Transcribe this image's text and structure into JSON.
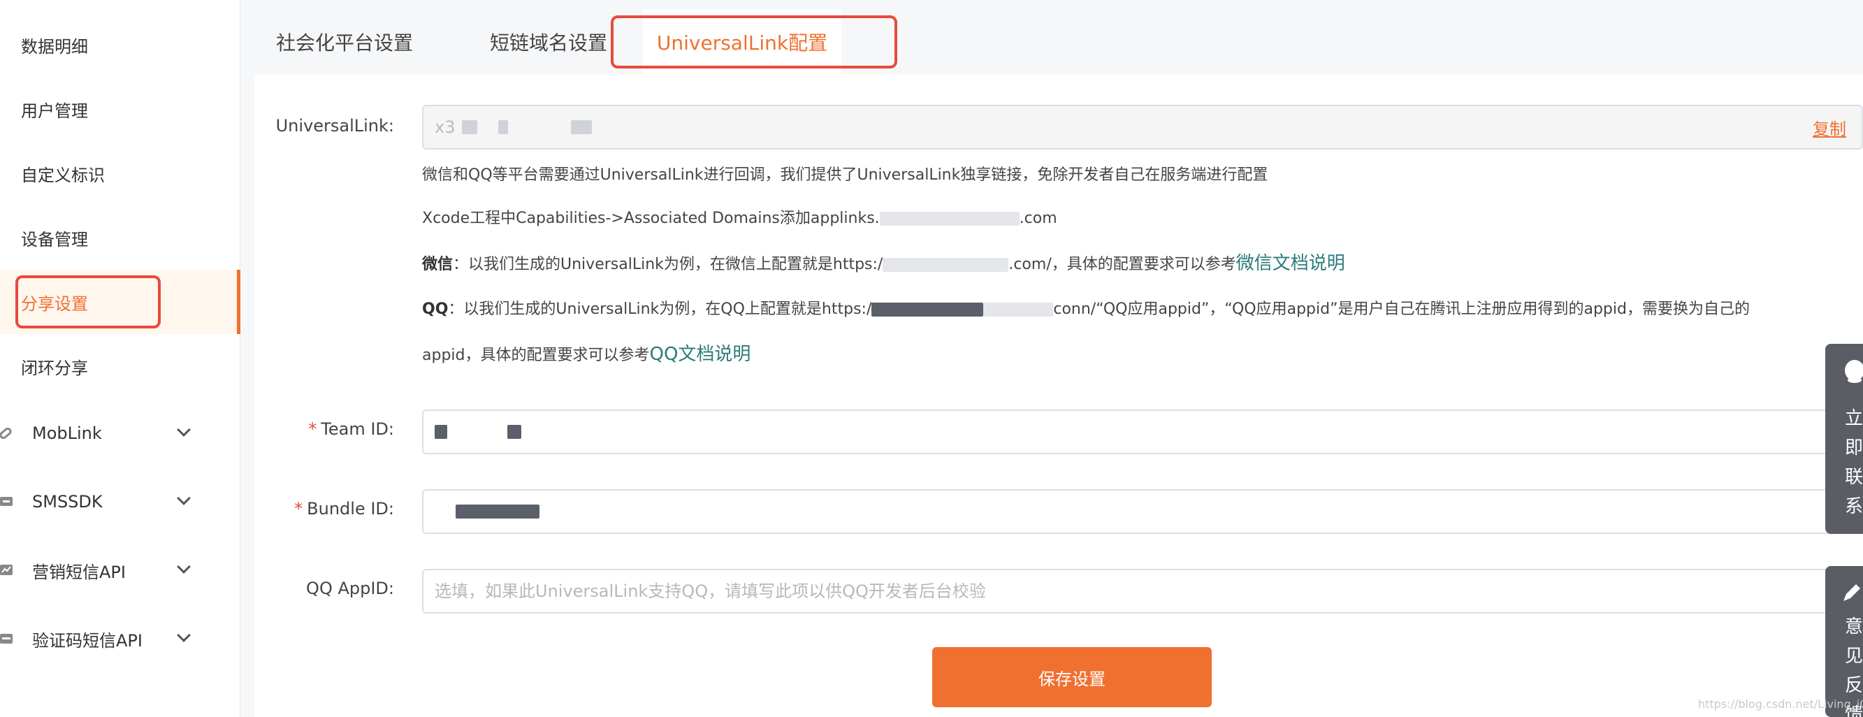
{
  "sidebar": {
    "items": [
      {
        "label": "数据明细"
      },
      {
        "label": "用户管理"
      },
      {
        "label": "自定义标识"
      },
      {
        "label": "设备管理"
      },
      {
        "label": "分享设置"
      },
      {
        "label": "闭环分享"
      }
    ],
    "groups": [
      {
        "label": "MobLink",
        "icon": "link-icon"
      },
      {
        "label": "SMSSDK",
        "icon": "message-icon"
      },
      {
        "label": "营销短信API",
        "icon": "chart-icon"
      },
      {
        "label": "验证码短信API",
        "icon": "api-icon"
      }
    ]
  },
  "tabs": [
    {
      "label": "社会化平台设置"
    },
    {
      "label": "短链域名设置"
    },
    {
      "label": "UniversalLink配置"
    }
  ],
  "form": {
    "universal_link": {
      "label": "UniversalLink:",
      "value": "x3",
      "copy": "复制"
    },
    "help": {
      "line1": "微信和QQ等平台需要通过UniversalLink进行回调，我们提供了UniversalLink独享链接，免除开发者自己在服务端进行配置",
      "line2_prefix": "Xcode工程中Capabilities->Associated Domains添加applinks.",
      "line2_suffix": ".com",
      "wx_label": "微信",
      "wx_text_a": "：以我们生成的UniversalLink为例，在微信上配置就是https:/",
      "wx_text_b": ".com/，具体的配置要求可以参考",
      "wx_link": "微信文档说明",
      "qq_label": "QQ",
      "qq_text_a": "：以我们生成的UniversalLink为例，在QQ上配置就是https:/",
      "qq_text_b": "conn/“QQ应用appid”，“QQ应用appid”是用户自己在腾讯上注册应用得到的appid，需要换为自己的",
      "qq_text_c": "appid，具体的配置要求可以参考",
      "qq_link": "QQ文档说明"
    },
    "team_id": {
      "label": "Team ID:",
      "required": "*"
    },
    "bundle_id": {
      "label": "Bundle ID:",
      "required": "*"
    },
    "qq_appid": {
      "label": "QQ AppID:",
      "placeholder": "选填，如果此UniversalLink支持QQ，请填写此项以供QQ开发者后台校验"
    },
    "save": "保存设置"
  },
  "float_contact": {
    "text": "立即联系",
    "icon": "qq-icon"
  },
  "float_feedback": {
    "text": "意见反馈",
    "icon": "pencil-icon"
  },
  "watermark": "https://blog.csdn.net/Living_iOS",
  "colors": {
    "accent": "#f07030",
    "highlight": "#e84a3c",
    "link": "#2c7a7b"
  }
}
